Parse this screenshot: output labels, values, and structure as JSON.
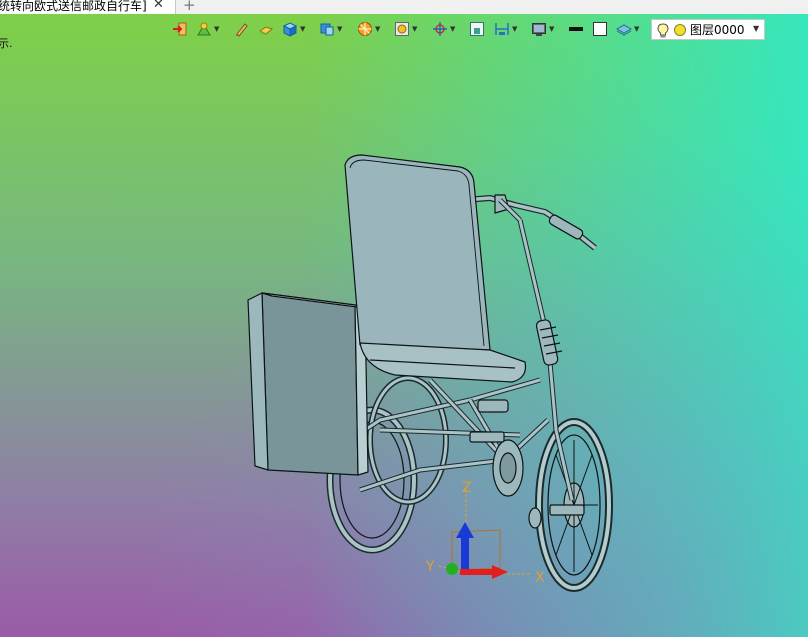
{
  "tab": {
    "title": "统转向欧式送信邮政自行车]",
    "close_glyph": "✕",
    "new_tab_glyph": "+"
  },
  "side_note": "示.",
  "toolbar": {
    "buttons": [
      {
        "icon": "import-icon",
        "has_dropdown": false
      },
      {
        "icon": "sketch-icon",
        "has_dropdown": true
      },
      {
        "icon": "edit-pen-icon",
        "has_dropdown": false
      },
      {
        "icon": "face-icon",
        "has_dropdown": false
      },
      {
        "icon": "solid-box-icon",
        "has_dropdown": true
      },
      {
        "icon": "view-orientation-icon",
        "has_dropdown": true
      },
      {
        "icon": "render-style-icon",
        "has_dropdown": true
      },
      {
        "icon": "zoom-fit-icon",
        "has_dropdown": true
      },
      {
        "icon": "snap-icon",
        "has_dropdown": true
      },
      {
        "icon": "section-icon",
        "has_dropdown": false
      },
      {
        "icon": "dimension-icon",
        "has_dropdown": true
      },
      {
        "icon": "display-icon",
        "has_dropdown": true
      },
      {
        "icon": "line-weight-icon",
        "has_dropdown": false
      },
      {
        "icon": "color-swatch-icon",
        "has_dropdown": false
      },
      {
        "icon": "layer-manager-icon",
        "has_dropdown": true
      }
    ],
    "layer_select": {
      "value": "图层0000",
      "bulb_icon": "lightbulb-icon",
      "color": "#f2e030"
    }
  },
  "triad": {
    "x_label": "X",
    "y_label": "Y",
    "z_label": "Z",
    "x_color": "#e02020",
    "y_color": "#20b020",
    "z_color": "#1a3ad8"
  },
  "colors": {
    "model_fill": "#9db8bc",
    "model_edge": "#0c1414"
  }
}
